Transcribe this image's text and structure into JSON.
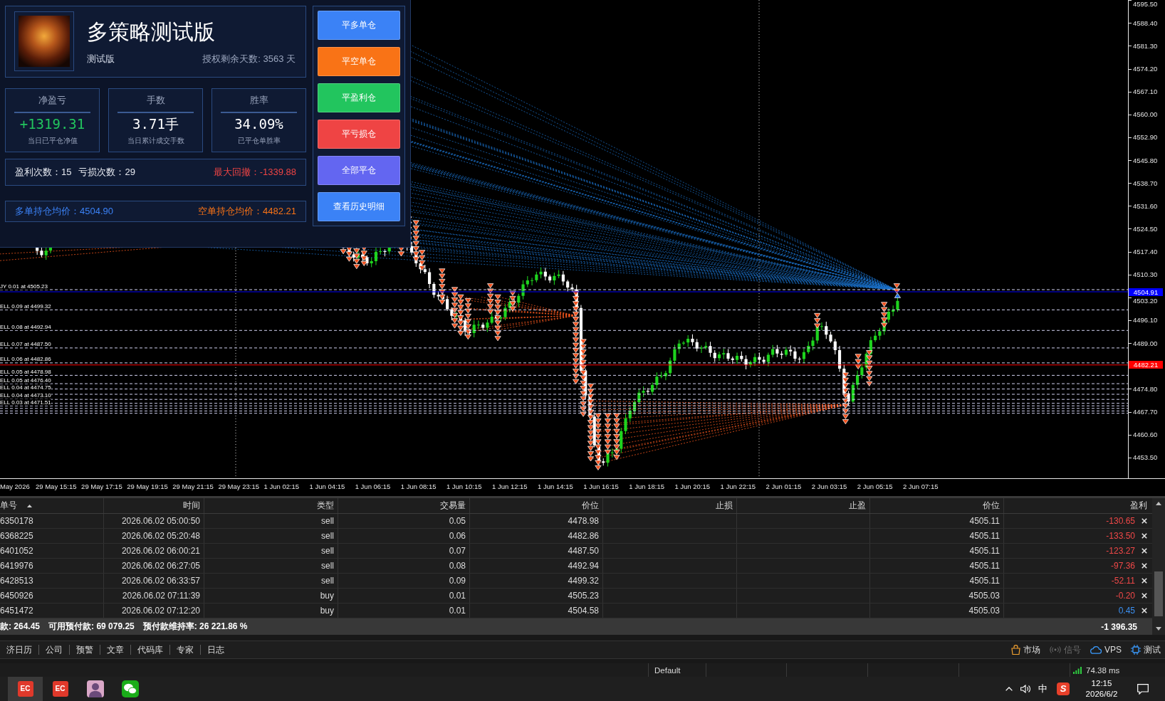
{
  "chart": {
    "order_lines": [
      {
        "label": "JY 0.01 at 4505.23"
      },
      {
        "label": "ELL 0.09 at 4499.32"
      },
      {
        "label": "ELL 0.08 at 4492.94"
      },
      {
        "label": "ELL 0.07 at 4487.50"
      },
      {
        "label": "ELL 0.06 at 4482.86"
      },
      {
        "label": "ELL 0.05 at 4478.98"
      },
      {
        "label": "ELL 0.05 at 4476.40"
      },
      {
        "label": "ELL 0.04 at 4474.75"
      },
      {
        "label": "ELL 0.04 at 4473.10"
      },
      {
        "label": "ELL 0.03 at 4471.51"
      }
    ],
    "price_axis": [
      "4595.50",
      "4588.40",
      "4581.30",
      "4574.20",
      "4567.10",
      "4560.00",
      "4552.90",
      "4545.80",
      "4538.70",
      "4531.60",
      "4524.50",
      "4517.40",
      "4510.30",
      "4503.20",
      "4496.10",
      "4489.00",
      "4474.80",
      "4467.70",
      "4460.60",
      "4453.50"
    ],
    "price_tags": [
      {
        "text": "4504.91",
        "color": "#0000ff"
      },
      {
        "text": "4482.21",
        "color": "#ff0000"
      }
    ],
    "time_axis": [
      "May 2026",
      "29 May 15:15",
      "29 May 17:15",
      "29 May 19:15",
      "29 May 21:15",
      "29 May 23:15",
      "1 Jun 02:15",
      "1 Jun 04:15",
      "1 Jun 06:15",
      "1 Jun 08:15",
      "1 Jun 10:15",
      "1 Jun 12:15",
      "1 Jun 14:15",
      "1 Jun 16:15",
      "1 Jun 18:15",
      "1 Jun 20:15",
      "1 Jun 22:15",
      "2 Jun 01:15",
      "2 Jun 03:15",
      "2 Jun 05:15",
      "2 Jun 07:15"
    ]
  },
  "ea_panel": {
    "title": "多策略测试版",
    "edition": "测试版",
    "license": "授权剩余天数: 3563 天",
    "stats": [
      {
        "label": "净盈亏",
        "value": "+1319.31",
        "caption": "当日已平仓净值",
        "color": "#22c55e"
      },
      {
        "label": "手数",
        "value": "3.71手",
        "caption": "当日累计成交手数",
        "color": "#ffffff"
      },
      {
        "label": "胜率",
        "value": "34.09%",
        "caption": "已平仓单胜率",
        "color": "#ffffff"
      }
    ],
    "win_count": "盈利次数：15",
    "loss_count": "亏损次数：29",
    "max_drawdown": "最大回撤：-1339.88",
    "long_avg_price": "多单持仓均价：4504.90",
    "short_avg_price": "空单持仓均价：4482.21",
    "buttons": [
      {
        "label": "平多单仓",
        "color": "#3b82f6"
      },
      {
        "label": "平空单仓",
        "color": "#f97316"
      },
      {
        "label": "平盈利仓",
        "color": "#22c55e"
      },
      {
        "label": "平亏损仓",
        "color": "#ef4444"
      },
      {
        "label": "全部平仓",
        "color": "#6366f1"
      },
      {
        "label": "查看历史明细",
        "color": "#3b82f6"
      }
    ]
  },
  "positions": {
    "columns": [
      "单号",
      "时间",
      "类型",
      "交易量",
      "价位",
      "止损",
      "止盈",
      "价位",
      "盈利"
    ],
    "rows": [
      {
        "ticket": "6350178",
        "time": "2026.06.02 05:00:50",
        "type": "sell",
        "volume": "0.05",
        "open_price": "4478.98",
        "price": "4505.11",
        "profit": "-130.65",
        "loss": true
      },
      {
        "ticket": "6368225",
        "time": "2026.06.02 05:20:48",
        "type": "sell",
        "volume": "0.06",
        "open_price": "4482.86",
        "price": "4505.11",
        "profit": "-133.50",
        "loss": true
      },
      {
        "ticket": "6401052",
        "time": "2026.06.02 06:00:21",
        "type": "sell",
        "volume": "0.07",
        "open_price": "4487.50",
        "price": "4505.11",
        "profit": "-123.27",
        "loss": true
      },
      {
        "ticket": "6419976",
        "time": "2026.06.02 06:27:05",
        "type": "sell",
        "volume": "0.08",
        "open_price": "4492.94",
        "price": "4505.11",
        "profit": "-97.36",
        "loss": true
      },
      {
        "ticket": "6428513",
        "time": "2026.06.02 06:33:57",
        "type": "sell",
        "volume": "0.09",
        "open_price": "4499.32",
        "price": "4505.11",
        "profit": "-52.11",
        "loss": true
      },
      {
        "ticket": "6450926",
        "time": "2026.06.02 07:11:39",
        "type": "buy",
        "volume": "0.01",
        "open_price": "4505.23",
        "price": "4505.03",
        "profit": "-0.20",
        "loss": true
      },
      {
        "ticket": "6451472",
        "time": "2026.06.02 07:12:20",
        "type": "buy",
        "volume": "0.01",
        "open_price": "4504.58",
        "price": "4505.03",
        "profit": "0.45",
        "loss": false
      }
    ],
    "summary": {
      "items": [
        "款: 264.45",
        "可用预付款: 69 079.25",
        "预付款维持率: 26 221.86 %"
      ],
      "total": "-1 396.35"
    }
  },
  "toolbox_tabs": [
    "济日历",
    "公司",
    "预警",
    "文章",
    "代码库",
    "专家",
    "日志"
  ],
  "services": [
    {
      "kind": "market",
      "label": "市场",
      "disabled": false
    },
    {
      "kind": "signals",
      "label": "信号",
      "disabled": true
    },
    {
      "kind": "vps",
      "label": "VPS",
      "disabled": false
    },
    {
      "kind": "tester",
      "label": "测试",
      "disabled": false
    }
  ],
  "status_bar": {
    "profile": "Default",
    "ping": "74.38 ms"
  },
  "taskbar": {
    "apps": [
      {
        "kind": "logo",
        "label": "EC",
        "selected": true
      },
      {
        "kind": "logo",
        "label": "EC",
        "selected": false
      },
      {
        "kind": "avatar",
        "selected": false
      },
      {
        "kind": "chat",
        "selected": false
      }
    ],
    "ime": "中",
    "ime_logo": "S",
    "time": "12:15",
    "date": "2026/6/2"
  }
}
